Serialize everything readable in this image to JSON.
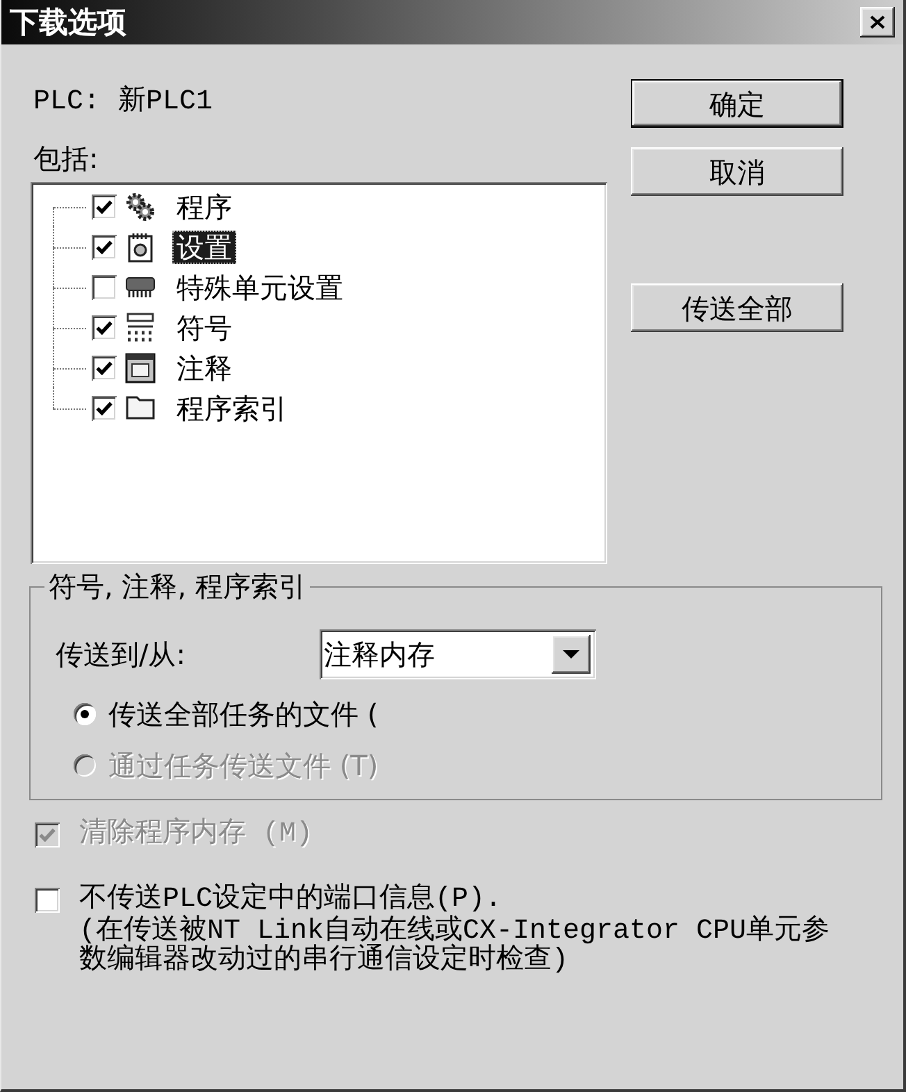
{
  "window": {
    "title": "下载选项"
  },
  "plc": {
    "label": "PLC:",
    "value": "新PLC1"
  },
  "include": {
    "label": "包括:",
    "items": [
      {
        "kind": "program",
        "label": "程序",
        "checked": true,
        "selected": false
      },
      {
        "kind": "settings",
        "label": "设置",
        "checked": true,
        "selected": true
      },
      {
        "kind": "unit",
        "label": "特殊单元设置",
        "checked": false,
        "selected": false
      },
      {
        "kind": "symbols",
        "label": "符号",
        "checked": true,
        "selected": false
      },
      {
        "kind": "comments",
        "label": "注释",
        "checked": true,
        "selected": false
      },
      {
        "kind": "index",
        "label": "程序索引",
        "checked": true,
        "selected": false
      }
    ]
  },
  "buttons": [
    {
      "label": "确定",
      "default": true
    },
    {
      "label": "取消",
      "default": false
    }
  ],
  "transfer_all_button": {
    "label": "传送全部"
  },
  "symbols_group": {
    "title": "符号, 注释, 程序索引",
    "transfer_label": "传送到/从:",
    "transfer_value": "注释内存",
    "options": [
      {
        "label": "传送全部任务的文件 (",
        "selected": true,
        "disabled": false
      },
      {
        "label": "通过任务传送文件 (T)",
        "selected": false,
        "disabled": true
      }
    ]
  },
  "checkboxes": [
    {
      "label": "清除程序内存 (M)",
      "checked": true,
      "disabled": true
    },
    {
      "label": "不传送PLC设定中的端口信息(P).",
      "checked": false,
      "disabled": false,
      "note": "(在传送被NT Link自动在线或CX-Integrator CPU单元参数编辑器改动过的串行通信设定时检查)"
    }
  ]
}
